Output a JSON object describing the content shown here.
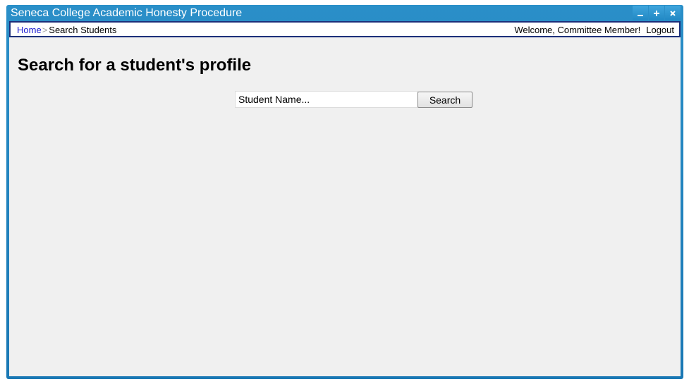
{
  "window": {
    "title": "Seneca College Academic Honesty Procedure",
    "controls": [
      "minimize-icon",
      "maximize-icon",
      "close-icon"
    ]
  },
  "nav": {
    "breadcrumb": {
      "home": "Home",
      "separator": ">",
      "current": "Search Students"
    },
    "welcome": "Welcome, Committee Member!",
    "logout": "Logout"
  },
  "main": {
    "title": "Search for a student's profile",
    "search": {
      "value": "",
      "placeholder": "Student Name...",
      "button_label": "Search"
    }
  },
  "colors": {
    "frame": "#1a78b4",
    "nav_border": "#1c2f7a",
    "link": "#1a1ad0",
    "client_bg": "#f0f0f0"
  }
}
